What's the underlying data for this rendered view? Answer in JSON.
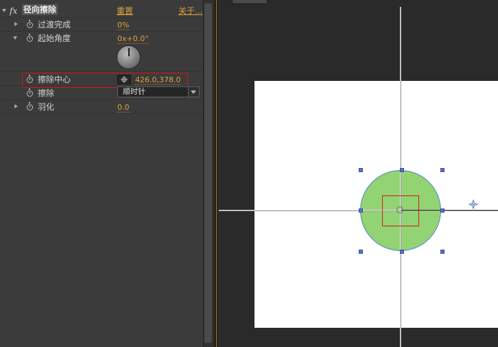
{
  "effect": {
    "fx_label": "fx",
    "name": "径向擦除",
    "reset_label": "重置",
    "about_label": "关于..."
  },
  "properties": [
    {
      "label": "过渡完成",
      "value": "0%"
    },
    {
      "label": "起始角度",
      "value": "0x+0.0°"
    },
    {
      "label": "擦除中心",
      "value": "426.0,378.0"
    },
    {
      "label": "擦除",
      "value": "顺时针"
    },
    {
      "label": "羽化",
      "value": "0.0"
    }
  ],
  "icons": {
    "twirl_open": "triangle-down-icon",
    "twirl_closed": "triangle-right-icon",
    "stopwatch": "stopwatch-icon",
    "anchor": "crosshair-target-icon",
    "dropdown": "chevron-down-icon"
  },
  "colors": {
    "value_orange": "#e0a23a",
    "highlight_red": "#d81616",
    "circle_fill": "#92d374",
    "handle_blue": "#5d72c6"
  }
}
